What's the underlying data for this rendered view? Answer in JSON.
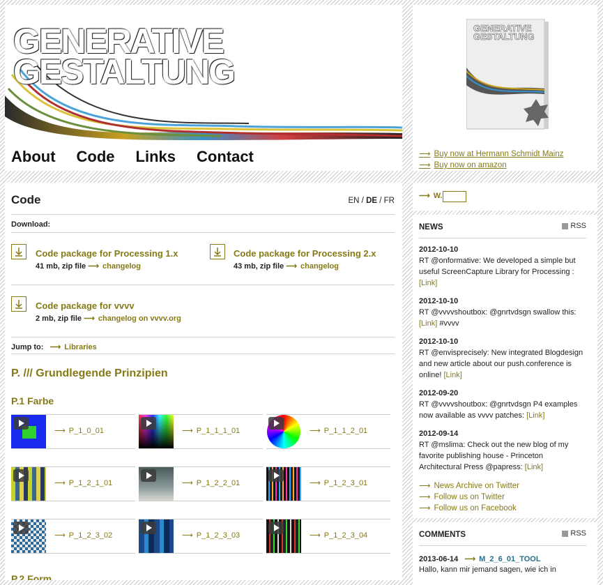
{
  "header": {
    "logo_line1": "GENERATIVE",
    "logo_line2": "GESTALTUNG",
    "nav": [
      "About",
      "Code",
      "Links",
      "Contact"
    ]
  },
  "book": {
    "buy_links": [
      "Buy now at Hermann Schmidt Mainz",
      "Buy now on amazon"
    ]
  },
  "main": {
    "heading": "Code",
    "lang": {
      "en": "EN",
      "sep1": " / ",
      "de": "DE",
      "sep2": " / ",
      "fr": "FR"
    },
    "download_label": "Download:",
    "downloads": [
      {
        "title": "Code package for Processing 1.x",
        "size": "41 mb, zip file",
        "link": "changelog"
      },
      {
        "title": "Code package for Processing 2.x",
        "size": "43 mb, zip file",
        "link": "changelog"
      },
      {
        "title": "Code package for vvvv",
        "size": "2 mb, zip file",
        "link": "changelog on vvvv.org"
      }
    ],
    "jump_label": "Jump to:",
    "jump_link": "Libraries",
    "section_title": "P. /// Grundlegende Prinzipien",
    "sub_title": "P.1 Farbe",
    "tiles": [
      "P_1_0_01",
      "P_1_1_1_01",
      "P_1_1_2_01",
      "P_1_2_1_01",
      "P_1_2_2_01",
      "P_1_2_3_01",
      "P_1_2_3_02",
      "P_1_2_3_03",
      "P_1_2_3_04"
    ],
    "next_section": "P.2 Form"
  },
  "sidebar": {
    "search_label": "W.",
    "news_heading": "NEWS",
    "rss_label": "RSS",
    "news": [
      {
        "date": "2012-10-10",
        "text": "RT @onformative: We developed a simple but useful ScreenCapture Library for Processing :",
        "link": "[Link]",
        "after": ""
      },
      {
        "date": "2012-10-10",
        "text": "RT @vvvvshoutbox: @gnrtvdsgn swallow this:",
        "link": "[Link]",
        "after": " #vvvv"
      },
      {
        "date": "2012-10-10",
        "text": "RT @envisprecisely: New integrated Blogdesign and new article about our push.conference is online!",
        "link": "[Link]",
        "after": ""
      },
      {
        "date": "2012-09-20",
        "text": "RT @vvvvshoutbox: @gnrtvdsgn P4 examples now available as vvvv patches:",
        "link": "[Link]",
        "after": ""
      },
      {
        "date": "2012-09-14",
        "text": "RT @mslima: Check out the new blog of my favorite publishing house - Princeton Architectural Press @papress:",
        "link": "[Link]",
        "after": ""
      }
    ],
    "news_links": [
      "News Archive on Twitter",
      "Follow us on Twitter",
      "Follow us on Facebook"
    ],
    "comments_heading": "COMMENTS",
    "comment_date": "2013-06-14",
    "comment_link": "M_2_6_01_TOOL",
    "comment_text": "Hallo, kann mir jemand sagen, wie ich in"
  },
  "colors": {
    "accent": "#857a16",
    "comment_link": "#2a6f8a"
  }
}
